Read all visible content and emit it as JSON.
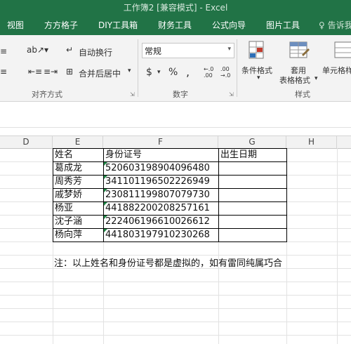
{
  "window": {
    "title": "工作簿2 [兼容模式] - Excel"
  },
  "tabs": [
    "视图",
    "方方格子",
    "DIY工具箱",
    "财务工具",
    "公式向导",
    "图片工具"
  ],
  "tell_me": "告诉我",
  "ribbon": {
    "wrap_text": "自动换行",
    "merge_center": "合并后居中",
    "number_format": "常规",
    "currency_symbol": "$",
    "percent_symbol": "%",
    "comma_symbol": ",",
    "increase_decimal": "←.0\n.00",
    "decrease_decimal": ".00\n→.0",
    "conditional_format": "条件格式",
    "table_format_line1": "套用",
    "table_format_line2": "表格格式",
    "cell_styles": "单元格样式",
    "group_alignment": "对齐方式",
    "group_number": "数字",
    "group_styles": "样式"
  },
  "columns": [
    "D",
    "E",
    "F",
    "G",
    "H"
  ],
  "table": {
    "headers": [
      "姓名",
      "身份证号",
      "出生日期"
    ],
    "rows": [
      {
        "name": "葛成龙",
        "id": "520603198904096480",
        "birth": ""
      },
      {
        "name": "周秀芳",
        "id": "341101196502226949",
        "birth": ""
      },
      {
        "name": "戚梦娇",
        "id": "230811199807079730",
        "birth": ""
      },
      {
        "name": "杨亚",
        "id": "441882200208257161",
        "birth": ""
      },
      {
        "name": "沈子涵",
        "id": "222406196610026612",
        "birth": ""
      },
      {
        "name": "杨向萍",
        "id": "441803197910230268",
        "birth": ""
      }
    ]
  },
  "note": "注：以上姓名和身份证号都是虚拟的，如有雷同纯属巧合",
  "colors": {
    "excel_green": "#217346",
    "error_triangle": "#1e8a45"
  }
}
